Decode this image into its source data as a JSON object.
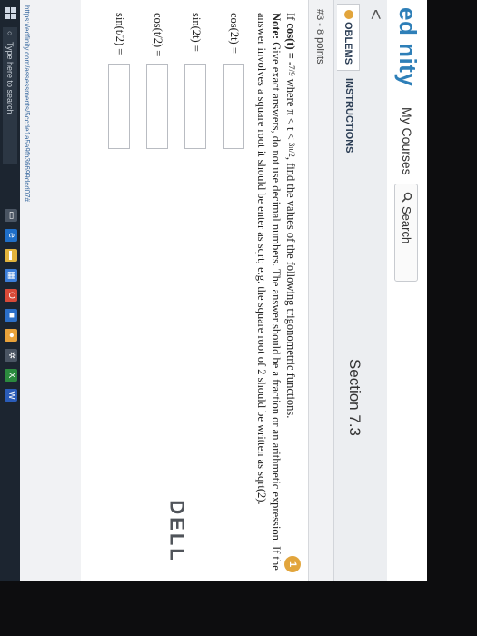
{
  "header": {
    "logo": "ed nity",
    "nav_courses": "My Courses",
    "search_label": "Search",
    "search_icon": "magnifier-icon"
  },
  "subheader": {
    "back_arrow": "<",
    "section_title": "Section 7.3",
    "tabs": [
      {
        "label": "OBLEMS"
      },
      {
        "label": "INSTRUCTIONS"
      }
    ]
  },
  "problem": {
    "points": "#3 - 8 points",
    "number": "1",
    "statement": {
      "p1": "If ",
      "given": "cos(t) = -",
      "given_frac": "7/9",
      "p2": " where π < t < ",
      "range_frac": "3π/2",
      "p3": ", find the values of the following trigonometric functions."
    },
    "note_label": "Note:",
    "note_text": " Give exact answers, do not use decimal numbers. The answer should be a fraction or an arithmetic expression. If the",
    "note_text2": "answer involves a square root it should be enter as sqrt; e.g. the square root of 2 should be written as sqrt(2).",
    "answers": [
      {
        "label": "cos(2t) ="
      },
      {
        "label": "sin(2t) ="
      },
      {
        "label": "cos(t/2) ="
      },
      {
        "label": "sin(t/2) ="
      }
    ]
  },
  "status_url": "https://edfinity.com/assessments/5ccde1a5a9fb36699dcd07#",
  "taskbar": {
    "search_placeholder": "Type here to search"
  },
  "bezel": {
    "brand": "DELL"
  },
  "colors": {
    "accent": "#2e7fb8",
    "badge": "#e2a53c",
    "taskbar": "#1c2530"
  }
}
